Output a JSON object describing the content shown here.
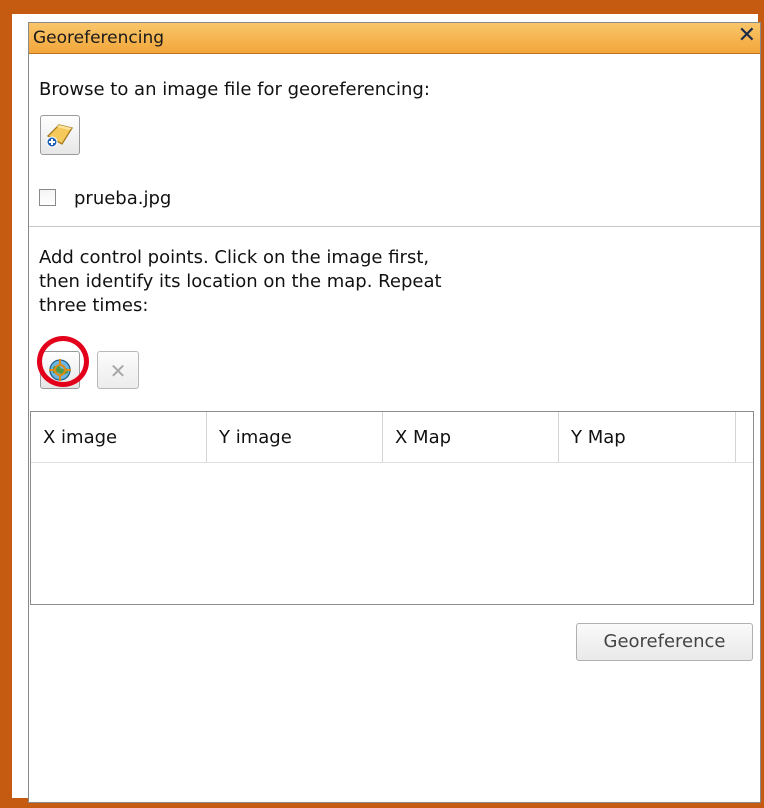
{
  "window": {
    "title": "Georeferencing",
    "close_glyph": "✕"
  },
  "browse": {
    "instruction": "Browse to an image file for georeferencing:",
    "icon": "add-image-icon"
  },
  "file": {
    "name": "prueba.jpg",
    "checked": false
  },
  "control_points": {
    "instruction_line1": "Add control points. Click on the image first,",
    "instruction_line2": "then identify its location on the map. Repeat",
    "instruction_line3": "three times:",
    "add_icon": "target-globe-icon",
    "delete_glyph": "✕"
  },
  "table": {
    "columns": [
      "X image",
      "Y image",
      "X Map",
      "Y Map"
    ],
    "rows": []
  },
  "actions": {
    "georeference_label": "Georeference"
  },
  "colors": {
    "frame": "#c55a11",
    "titlebar": "#f2a63a",
    "highlight_circle": "#e3001b"
  }
}
